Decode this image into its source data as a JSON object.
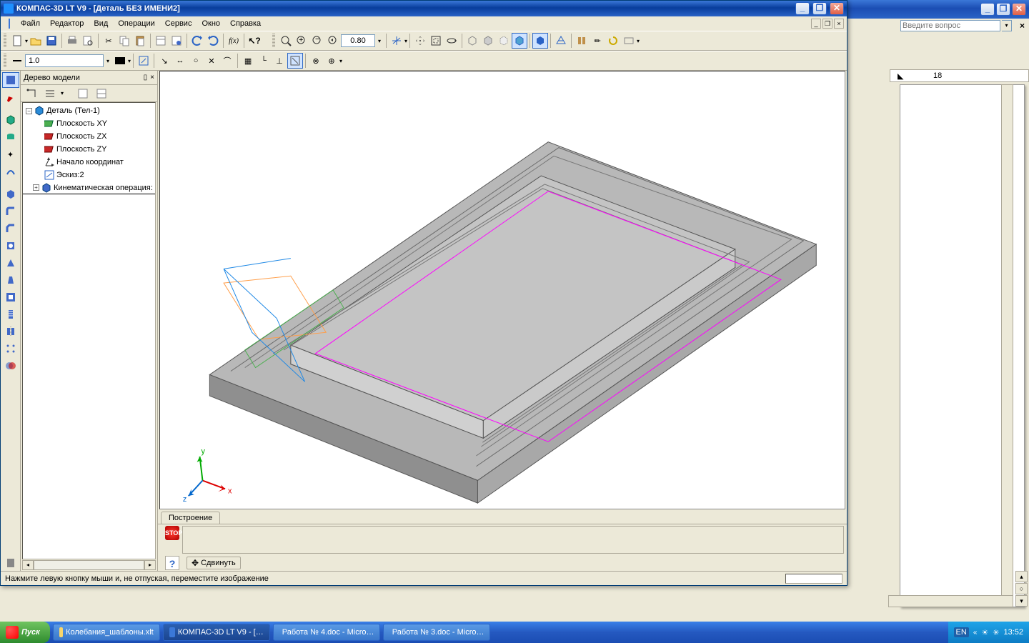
{
  "outer": {
    "help_placeholder": "Введите вопрос",
    "ruler_mark": "18"
  },
  "app": {
    "title": "КОМПАС-3D LT V9 - [Деталь БЕЗ ИМЕНИ2]"
  },
  "menu": {
    "file": "Файл",
    "editor": "Редактор",
    "view": "Вид",
    "operations": "Операции",
    "service": "Сервис",
    "window": "Окно",
    "help": "Справка"
  },
  "toolbar": {
    "scale_value": "1.0",
    "zoom_value": "0.80"
  },
  "panel": {
    "title": "Дерево модели"
  },
  "tree": {
    "root": "Деталь (Тел-1)",
    "plane_xy": "Плоскость XY",
    "plane_zx": "Плоскость ZX",
    "plane_zy": "Плоскость ZY",
    "origin": "Начало координат",
    "sketch": "Эскиз:2",
    "op": "Кинематическая операция:"
  },
  "bottom_tab": "Построение",
  "command_button": "Сдвинуть",
  "statusbar": "Нажмите левую кнопку мыши и, не отпуская, переместите изображение",
  "taskbar": {
    "start": "Пуск",
    "items": [
      "Колебания_шаблоны.xlt",
      "КОМПАС-3D LT V9 - […",
      "Работа № 4.doc - Micro…",
      "Работа № 3.doc - Micro…"
    ],
    "lang": "EN",
    "time": "13:52"
  },
  "axes": {
    "x": "x",
    "y": "y",
    "z": "z"
  }
}
